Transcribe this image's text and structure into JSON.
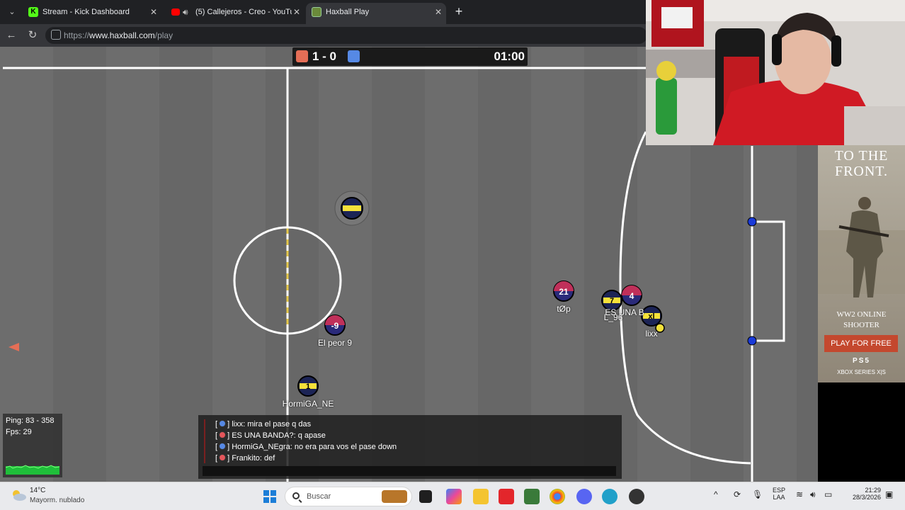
{
  "browser": {
    "tabs": [
      {
        "title": "Stream - Kick Dashboard",
        "close": "✕",
        "favicon_color": "#53fc18",
        "favicon_letter": "K"
      },
      {
        "title": "(5) Callejeros - Creo - YouTube",
        "close": "✕",
        "favicon_color": "#ff0000",
        "favicon_letter": ""
      },
      {
        "title": "Haxball Play",
        "close": "✕",
        "favicon_color": "#6a8a3a",
        "favicon_letter": ""
      }
    ],
    "new_tab": "+",
    "url_prefix": "https://",
    "url_host": "www.haxball.com",
    "url_path": "/play"
  },
  "scoreboard": {
    "score": "1 - 0",
    "time": "01:00"
  },
  "players": [
    {
      "label": "",
      "number": "",
      "team": "yellow",
      "name": ""
    },
    {
      "label": "El peor 9",
      "number": "-9",
      "team": "red"
    },
    {
      "label": "HormiGA_NE",
      "number": "1",
      "team": "yellow"
    },
    {
      "label": "tØp",
      "number": "21",
      "team": "red"
    },
    {
      "label": "L_96",
      "number": "7",
      "team": "yellow"
    },
    {
      "label": "ES UNA B",
      "number": "4",
      "team": "red"
    },
    {
      "label": "lixx",
      "number": "xl",
      "team": "yellow"
    }
  ],
  "stats": {
    "ping": "Ping: 83 - 358",
    "fps": "Fps: 29"
  },
  "chat": [
    {
      "team": "blue",
      "text": "lixx: mira el pase q das"
    },
    {
      "team": "red",
      "text": "ES UNA BANDA?: q apase"
    },
    {
      "team": "blue",
      "text": "HormiGA_NEgra: no era para vos el pase down"
    },
    {
      "team": "red",
      "text": "Frankito: def"
    }
  ],
  "ad": {
    "headline": "TO THE FRONT.",
    "sub": "WW2 ONLINE SHOOTER",
    "cta": "PLAY FOR FREE",
    "platform1": "PS5",
    "platform2": "XBOX SERIES X|S"
  },
  "taskbar": {
    "temp": "14°C",
    "weather": "Mayorm. nublado",
    "search_placeholder": "Buscar",
    "lang1": "ESP",
    "lang2": "LAA",
    "time": "21:29",
    "date": "28/3/2026"
  },
  "colors": {
    "team_red": "#e56e56",
    "team_blue": "#5689e5",
    "field": "#6a6a6a",
    "ball_yellow": "#f5e13a"
  }
}
